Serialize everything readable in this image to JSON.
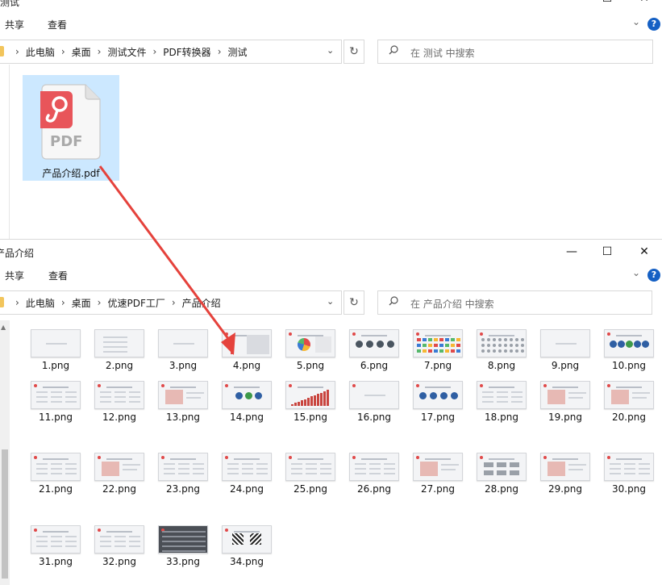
{
  "window1": {
    "title": "测试",
    "tabs": [
      "共享",
      "查看"
    ],
    "breadcrumb": [
      "此电脑",
      "桌面",
      "测试文件",
      "PDF转换器",
      "测试"
    ],
    "search_placeholder": "在 测试 中搜索",
    "file": {
      "name": "产品介绍.pdf",
      "icon": "pdf-file-icon",
      "badge_text": "PDF"
    }
  },
  "window2": {
    "title": "产品介绍",
    "tabs": [
      "共享",
      "查看"
    ],
    "breadcrumb": [
      "此电脑",
      "桌面",
      "优速PDF工厂",
      "产品介绍"
    ],
    "search_placeholder": "在 产品介绍 中搜索",
    "files": [
      "1.png",
      "2.png",
      "3.png",
      "4.png",
      "5.png",
      "6.png",
      "7.png",
      "8.png",
      "9.png",
      "10.png",
      "11.png",
      "12.png",
      "13.png",
      "14.png",
      "15.png",
      "16.png",
      "17.png",
      "18.png",
      "19.png",
      "20.png",
      "21.png",
      "22.png",
      "23.png",
      "24.png",
      "25.png",
      "26.png",
      "27.png",
      "28.png",
      "29.png",
      "30.png",
      "31.png",
      "32.png",
      "33.png",
      "34.png"
    ]
  },
  "icons": {
    "minimize": "minimize-icon",
    "maximize": "maximize-icon",
    "close": "close-icon",
    "help": "help-icon",
    "search": "search-icon",
    "refresh": "refresh-icon",
    "dropdown": "chevron-down-icon"
  },
  "colors": {
    "selection": "#cce8ff",
    "pdf_brand": "#e8555a",
    "arrow": "#e5423c",
    "help_blue": "#1560c4"
  }
}
